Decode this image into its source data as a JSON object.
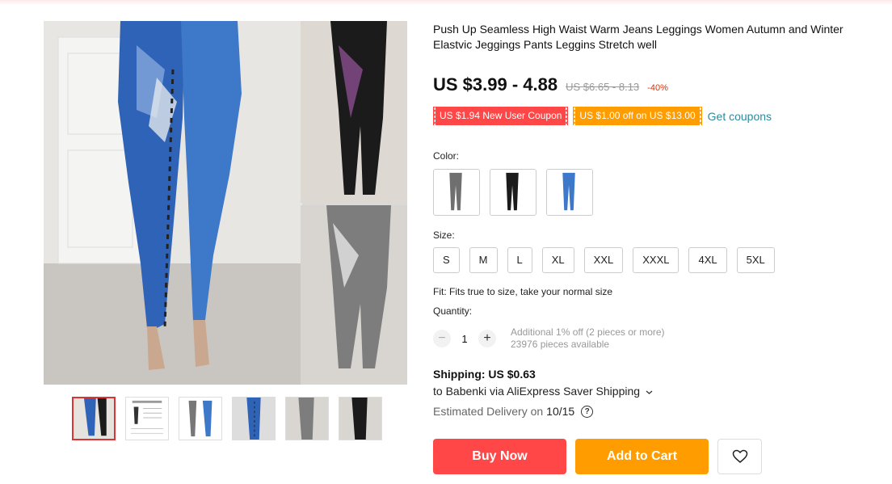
{
  "product": {
    "title": "Push Up Seamless High Waist Warm Jeans Leggings Women Autumn and Winter Elastvic Jeggings Pants Leggins Stretch well",
    "price": "US $3.99 - 4.88",
    "original_price": "US $6.65 - 8.13",
    "discount": "-40%"
  },
  "coupons": {
    "new_user": "US $1.94 New User Coupon",
    "store": "US $1.00 off on US $13.00",
    "get_label": "Get coupons"
  },
  "color": {
    "label": "Color:",
    "options": [
      "gray",
      "black",
      "blue"
    ]
  },
  "size": {
    "label": "Size:",
    "options": [
      "S",
      "M",
      "L",
      "XL",
      "XXL",
      "XXXL",
      "4XL",
      "5XL"
    ]
  },
  "fit": "Fit: Fits true to size, take your normal size",
  "quantity": {
    "label": "Quantity:",
    "value": "1",
    "minus": "−",
    "plus": "+",
    "discount_note": "Additional 1% off (2 pieces or more)",
    "available": "23976 pieces available"
  },
  "shipping": {
    "cost": "Shipping: US $0.63",
    "to": "to Babenki via AliExpress Saver Shipping",
    "delivery_label": "Estimated Delivery on",
    "delivery_date": "10/15"
  },
  "buttons": {
    "buy": "Buy Now",
    "cart": "Add to Cart"
  },
  "icons": {
    "help": "question-circle-icon",
    "wishlist": "heart-icon",
    "dropdown": "chevron-down-icon"
  },
  "colors": {
    "red": "#ff4747",
    "orange": "#ff9c00",
    "link": "#2a8c9d"
  }
}
